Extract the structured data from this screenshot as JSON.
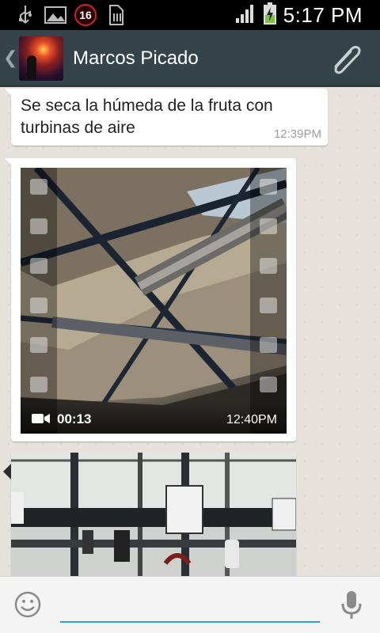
{
  "status_bar": {
    "notification_count": "16",
    "clock": "5:17 PM",
    "icons": [
      "usb-icon",
      "gallery-icon",
      "notification-badge",
      "sim-storage-icon",
      "signal-icon",
      "battery-charging-icon"
    ]
  },
  "header": {
    "contact_name": "Marcos Picado",
    "icons": [
      "back-chevron-icon",
      "attach-icon"
    ]
  },
  "messages": [
    {
      "type": "text",
      "text": "Se seca la húmeda de la fruta con turbinas de aire",
      "time": "12:39PM"
    },
    {
      "type": "video",
      "duration": "00:13",
      "time": "12:40PM"
    },
    {
      "type": "image"
    }
  ],
  "input": {
    "value": "",
    "placeholder": ""
  },
  "colors": {
    "header": "#34444a",
    "chat_background": "#ece5dd",
    "input_underline": "#2aa2d4",
    "bubble": "#ffffff"
  }
}
